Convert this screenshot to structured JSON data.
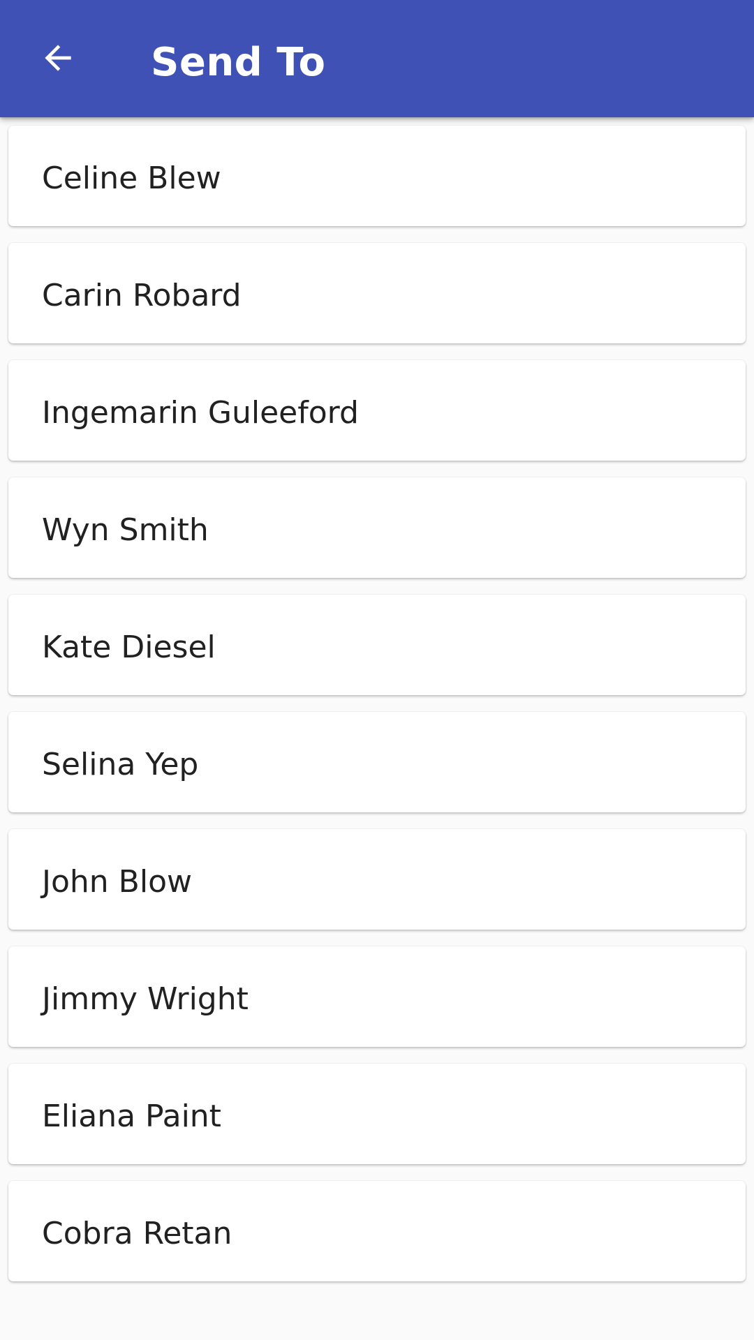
{
  "app_bar": {
    "title": "Send To",
    "back_icon": "arrow-left-icon",
    "background_color": "#3f51b5",
    "title_color": "#ffffff"
  },
  "contacts": [
    {
      "name": "Celine Blew"
    },
    {
      "name": "Carin Robard"
    },
    {
      "name": "Ingemarin Guleeford"
    },
    {
      "name": "Wyn Smith"
    },
    {
      "name": "Kate Diesel"
    },
    {
      "name": "Selina Yep"
    },
    {
      "name": "John Blow"
    },
    {
      "name": "Jimmy Wright"
    },
    {
      "name": "Eliana Paint"
    },
    {
      "name": "Cobra Retan"
    }
  ]
}
